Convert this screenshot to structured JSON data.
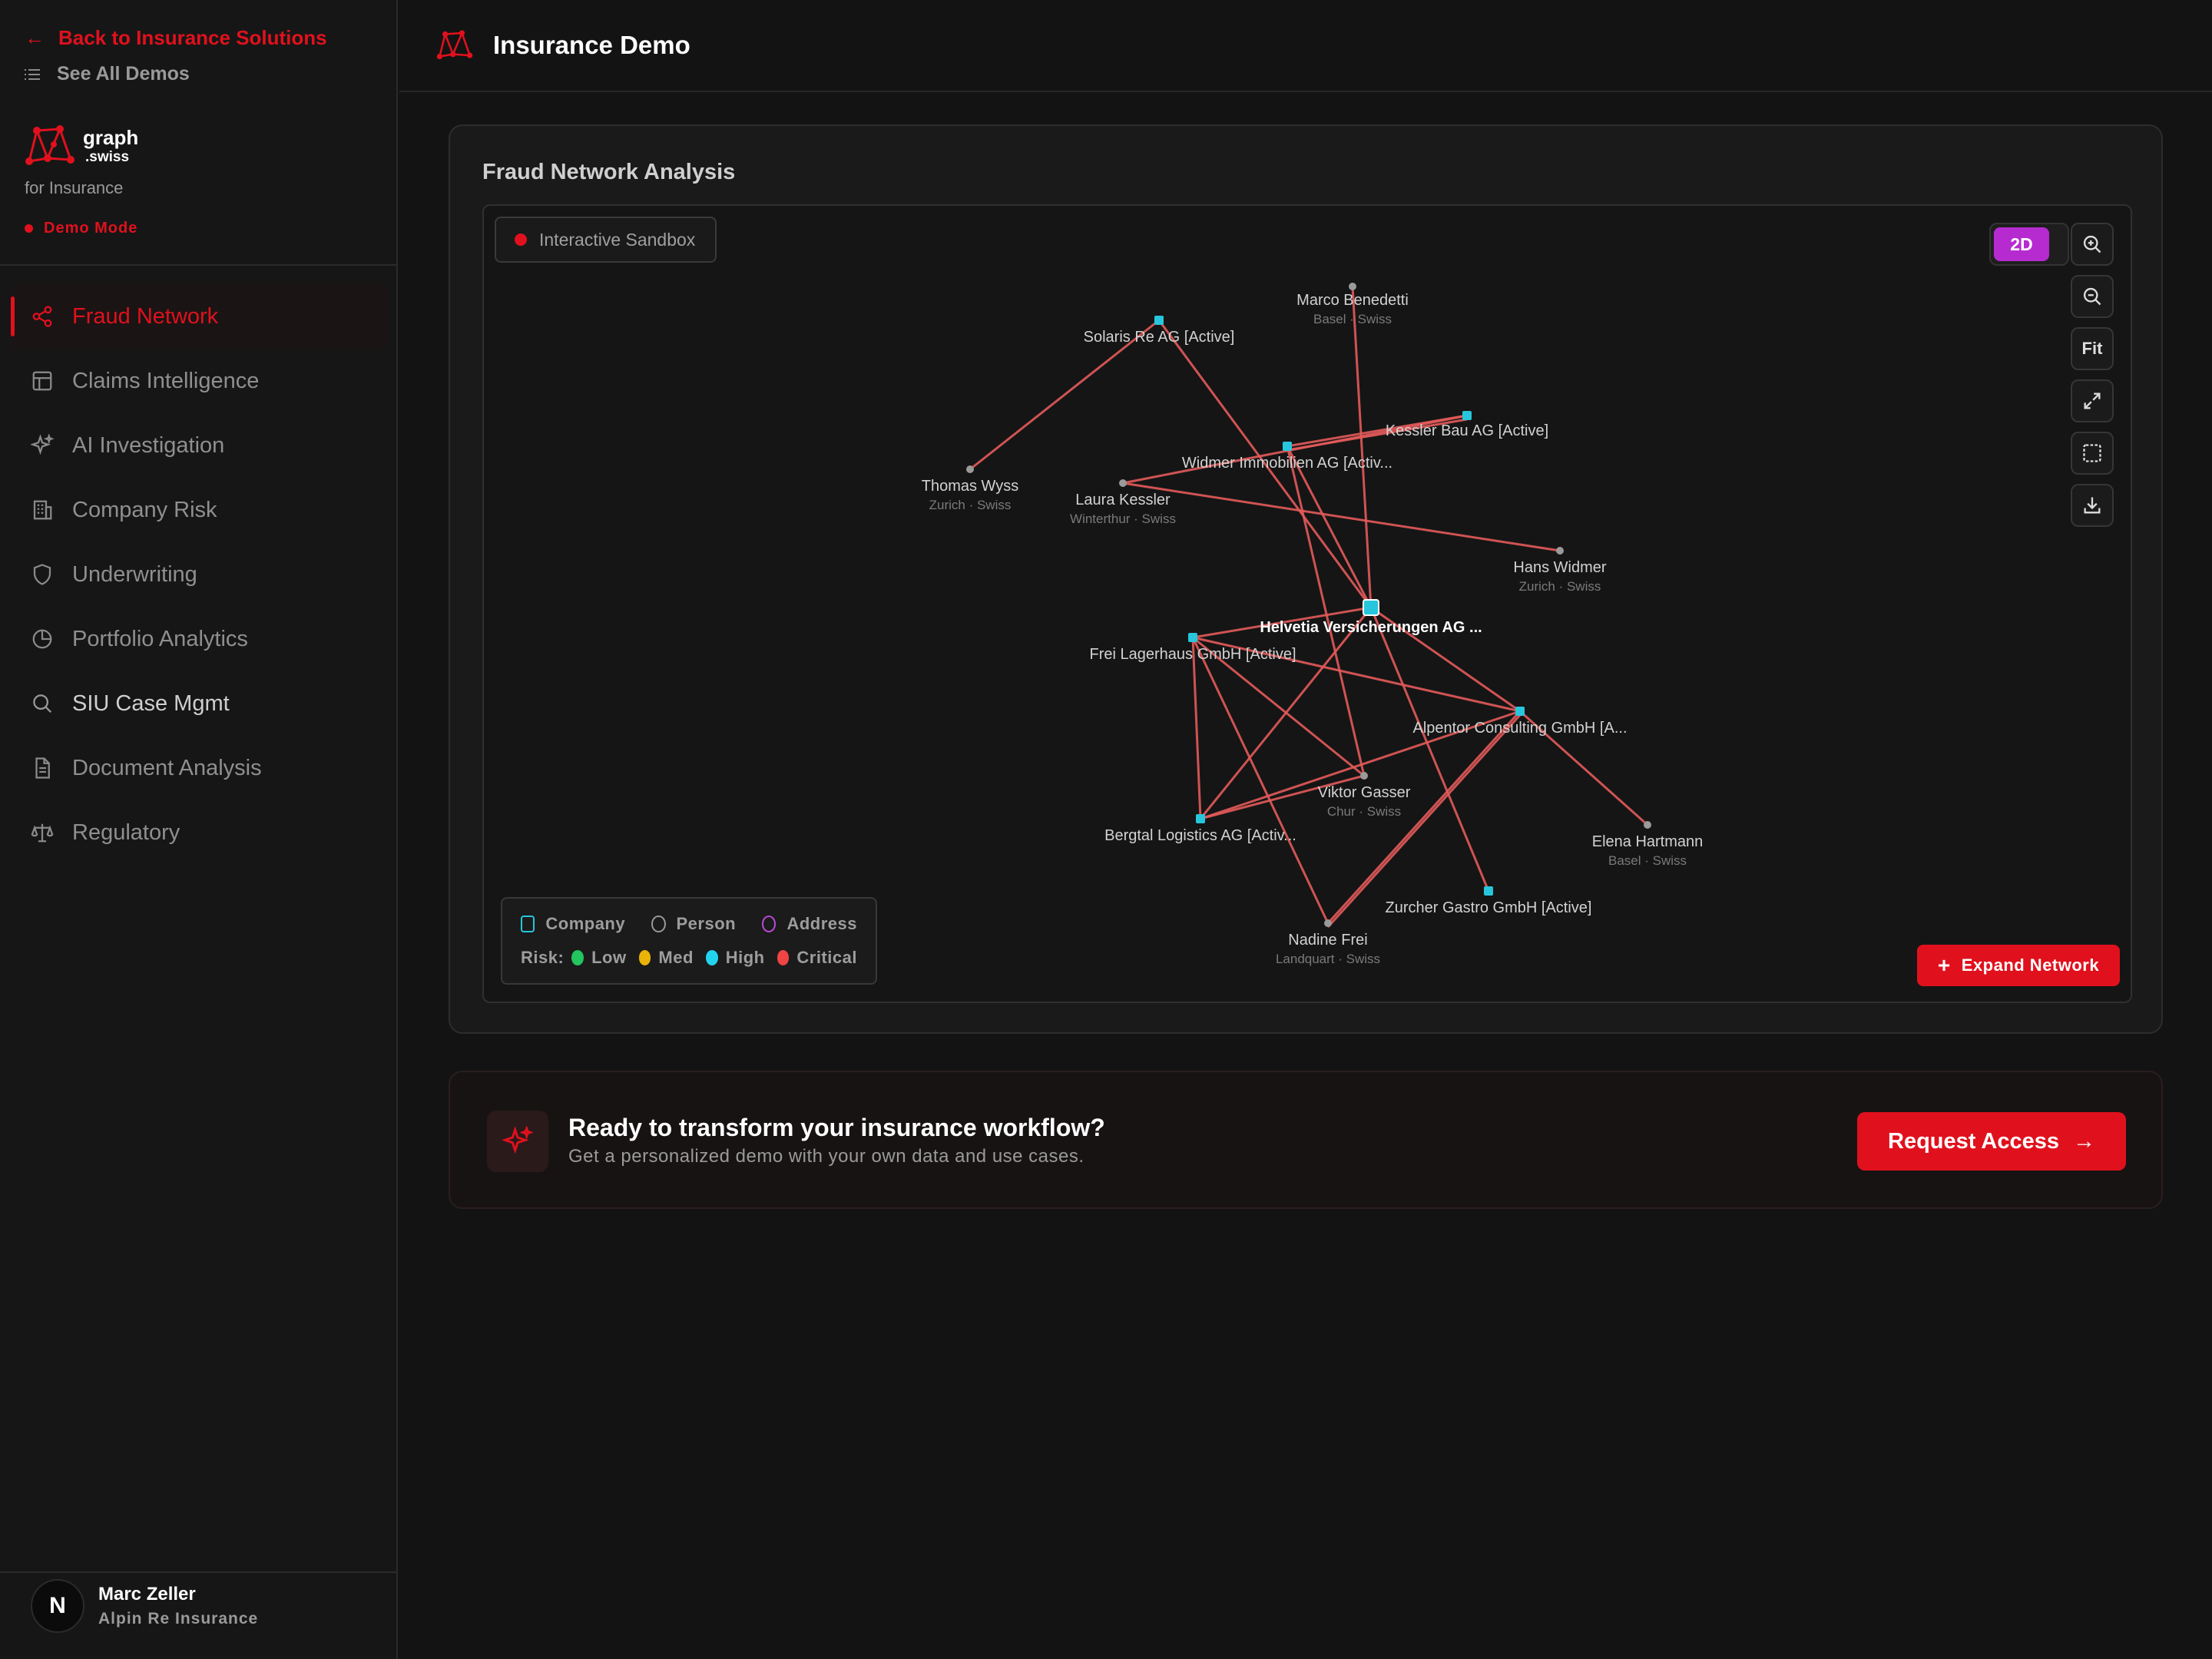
{
  "sidebar": {
    "back_label": "Back to Insurance Solutions",
    "demos_label": "See All Demos",
    "brand_name": "graph",
    "brand_suffix": ".swiss",
    "brand_tagline": "for Insurance",
    "mode_label": "Demo Mode",
    "nav": [
      {
        "label": "Fraud Network",
        "icon": "share-nodes-icon",
        "active": true
      },
      {
        "label": "Claims Intelligence",
        "icon": "table-icon"
      },
      {
        "label": "AI Investigation",
        "icon": "sparkles-icon"
      },
      {
        "label": "Company Risk",
        "icon": "building-icon"
      },
      {
        "label": "Underwriting",
        "icon": "shield-icon"
      },
      {
        "label": "Portfolio Analytics",
        "icon": "pie-chart-icon"
      },
      {
        "label": "SIU Case Mgmt",
        "icon": "search-icon"
      },
      {
        "label": "Document Analysis",
        "icon": "document-icon"
      },
      {
        "label": "Regulatory",
        "icon": "scale-icon"
      }
    ],
    "user": {
      "initial": "N",
      "name": "Marc Zeller",
      "org": "Alpin Re Insurance"
    }
  },
  "header": {
    "title": "Insurance Demo"
  },
  "card": {
    "title": "Fraud Network Analysis",
    "sandbox_label": "Interactive Sandbox",
    "view_mode": "2D",
    "fit_label": "Fit",
    "expand_label": "Expand Network",
    "legend": {
      "company": "Company",
      "person": "Person",
      "address": "Address",
      "risk_label": "Risk:",
      "low": "Low",
      "med": "Med",
      "high": "High",
      "critical": "Critical"
    },
    "graph": {
      "nodes": [
        {
          "id": "marco",
          "type": "person",
          "label": "Marco Benedetti",
          "sub": "Basel · Swiss"
        },
        {
          "id": "solaris",
          "type": "company",
          "label": "Solaris Re AG [Active]",
          "sub": ""
        },
        {
          "id": "kessler_bau",
          "type": "company",
          "label": "Kessler Bau AG [Active]",
          "sub": ""
        },
        {
          "id": "widmer_imm",
          "type": "company",
          "label": "Widmer Immobilien AG [Activ...",
          "sub": ""
        },
        {
          "id": "thomas",
          "type": "person",
          "label": "Thomas Wyss",
          "sub": "Zurich · Swiss"
        },
        {
          "id": "laura",
          "type": "person",
          "label": "Laura Kessler",
          "sub": "Winterthur · Swiss"
        },
        {
          "id": "hans",
          "type": "person",
          "label": "Hans Widmer",
          "sub": "Zurich · Swiss"
        },
        {
          "id": "helvetia",
          "type": "company",
          "label": "Helvetia Versicherungen AG ...",
          "sub": "",
          "focus": true
        },
        {
          "id": "frei",
          "type": "company",
          "label": "Frei Lagerhaus GmbH [Active]",
          "sub": ""
        },
        {
          "id": "alpentor",
          "type": "company",
          "label": "Alpentor Consulting GmbH [A...",
          "sub": ""
        },
        {
          "id": "viktor",
          "type": "person",
          "label": "Viktor Gasser",
          "sub": "Chur · Swiss"
        },
        {
          "id": "bergtal",
          "type": "company",
          "label": "Bergtal Logistics AG [Activ...",
          "sub": ""
        },
        {
          "id": "elena",
          "type": "person",
          "label": "Elena Hartmann",
          "sub": "Basel · Swiss"
        },
        {
          "id": "zurcher",
          "type": "company",
          "label": "Zurcher Gastro GmbH [Active]",
          "sub": ""
        },
        {
          "id": "nadine",
          "type": "person",
          "label": "Nadine Frei",
          "sub": "Landquart · Swiss"
        }
      ]
    }
  },
  "cta": {
    "title": "Ready to transform your insurance workflow?",
    "subtitle": "Get a personalized demo with your own data and use cases.",
    "button_label": "Request Access"
  },
  "colors": {
    "accent": "#e0111d",
    "company": "#27c6dc",
    "mode": "#b62bd0",
    "edge": "#e35a5a",
    "low": "#22c55e",
    "med": "#eab308",
    "high": "#22d3ee",
    "critical": "#ef4444"
  }
}
